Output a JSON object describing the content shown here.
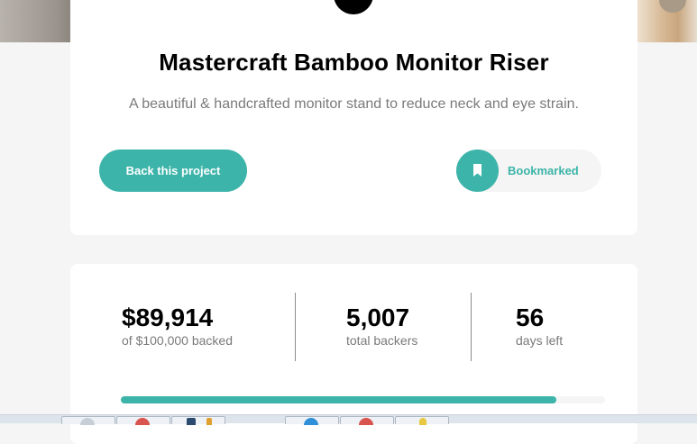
{
  "project": {
    "title": "Mastercraft Bamboo Monitor Riser",
    "description": "A beautiful & handcrafted monitor stand to reduce neck and eye strain.",
    "back_label": "Back this project",
    "bookmark_label": "Bookmarked"
  },
  "stats": {
    "amount": "$89,914",
    "amount_label": "of $100,000 backed",
    "backers": "5,007",
    "backers_label": "total backers",
    "days": "56",
    "days_label": "days left"
  },
  "progress": {
    "fraction": 0.89914
  },
  "colors": {
    "accent": "#3cb4a9",
    "background": "#f4f5f4",
    "text_muted": "#7a7a7a"
  },
  "icons": {
    "logo": "logo-icon",
    "bookmark": "bookmark-icon"
  }
}
